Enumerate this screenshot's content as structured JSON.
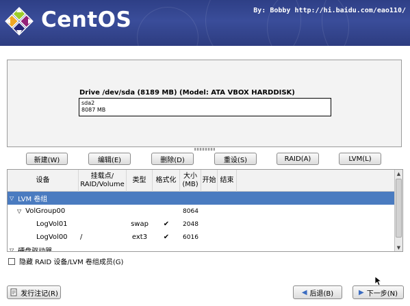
{
  "banner": {
    "logo_text": "CentOS",
    "credit": "By: Bobby http://hi.baidu.com/eao110/"
  },
  "drive": {
    "title": "Drive /dev/sda (8189 MB) (Model: ATA VBOX HARDDISK)",
    "partition_name": "sda2",
    "partition_size": "8087 MB"
  },
  "toolbar": {
    "new_label": "新建(W)",
    "edit_label": "编辑(E)",
    "delete_label": "删除(D)",
    "reset_label": "重设(S)",
    "raid_label": "RAID(A)",
    "lvm_label": "LVM(L)"
  },
  "table": {
    "headers": {
      "device": "设备",
      "mount": "挂载点/\nRAID/Volume",
      "type": "类型",
      "format": "格式化",
      "size": "大小\n(MB)",
      "start": "开始",
      "end": "结束"
    },
    "rows": [
      {
        "device": "LVM 卷组",
        "mount": "",
        "type": "",
        "format": "",
        "size": "",
        "start": "",
        "end": "",
        "selected": true,
        "level": 0,
        "expander": "▽"
      },
      {
        "device": "VolGroup00",
        "mount": "",
        "type": "",
        "format": "",
        "size": "8064",
        "start": "",
        "end": "",
        "selected": false,
        "level": 1,
        "expander": "▽"
      },
      {
        "device": "LogVol01",
        "mount": "",
        "type": "swap",
        "format": "✔",
        "size": "2048",
        "start": "",
        "end": "",
        "selected": false,
        "level": 2,
        "expander": ""
      },
      {
        "device": "LogVol00",
        "mount": "/",
        "type": "ext3",
        "format": "✔",
        "size": "6016",
        "start": "",
        "end": "",
        "selected": false,
        "level": 2,
        "expander": ""
      },
      {
        "device": "硬盘驱动器",
        "mount": "",
        "type": "",
        "format": "",
        "size": "",
        "start": "",
        "end": "",
        "selected": false,
        "level": 0,
        "expander": "▽"
      }
    ]
  },
  "options": {
    "hide_raid_label": "隐藏 RAID 设备/LVM 卷组成员(G)",
    "hide_raid_checked": false
  },
  "footer": {
    "release_notes_label": "发行注记(R)",
    "back_label": "后退(B)",
    "next_label": "下一步(N)"
  }
}
